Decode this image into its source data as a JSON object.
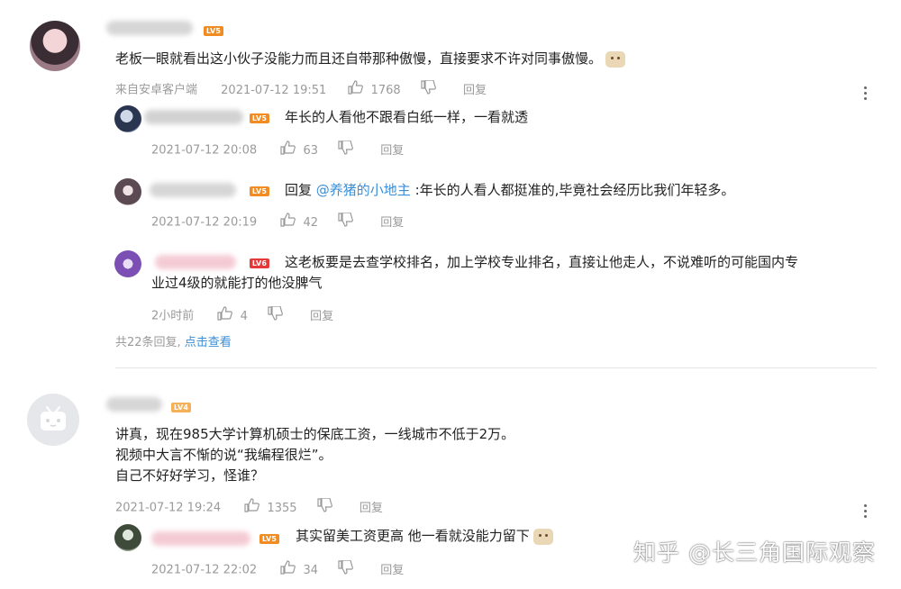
{
  "colors": {
    "level_badge": "#f08c22",
    "level_badge_red": "#e53939",
    "link": "#3a8ed8",
    "meta": "#9a9a9a"
  },
  "comments": [
    {
      "level": "LV5",
      "text": "老板一眼就看出这小伙子没能力而且还自带那种傲慢，直接要求不许对同事傲慢。",
      "source": "来自安卓客户端",
      "time": "2021-07-12 19:51",
      "likes": "1768",
      "reply_label": "回复",
      "replies": [
        {
          "level": "LV5",
          "text": "年长的人看他不跟看白纸一样，一看就透",
          "time": "2021-07-12 20:08",
          "likes": "63",
          "reply_label": "回复"
        },
        {
          "level": "LV5",
          "reply_prefix": "回复",
          "mention": "@养猪的小地主",
          "text": ":年长的人看人都挺准的,毕竟社会经历比我们年轻多。",
          "time": "2021-07-12 20:19",
          "likes": "42",
          "reply_label": "回复"
        },
        {
          "level": "LV6",
          "text_line1": "这老板要是去查学校排名，加上学校专业排名，直接让他走人，不说难听的可能国内专",
          "text_line2": "业过4级的就能打的他没脾气",
          "time": "2小时前",
          "likes": "4",
          "reply_label": "回复"
        }
      ],
      "footer_total": "共22条回复,",
      "footer_link": "点击查看"
    },
    {
      "level": "LV4",
      "line1": "讲真，现在985大学计算机硕士的保底工资，一线城市不低于2万。",
      "line2": "视频中大言不惭的说“我编程很烂”。",
      "line3": "自己不好好学习，怪谁？",
      "time": "2021-07-12 19:24",
      "likes": "1355",
      "reply_label": "回复",
      "replies": [
        {
          "level": "LV5",
          "text": "其实留美工资更高 他一看就没能力留下",
          "time": "2021-07-12 22:02",
          "likes": "34",
          "reply_label": "回复"
        }
      ]
    }
  ],
  "watermark": "知乎 @长三角国际观察"
}
